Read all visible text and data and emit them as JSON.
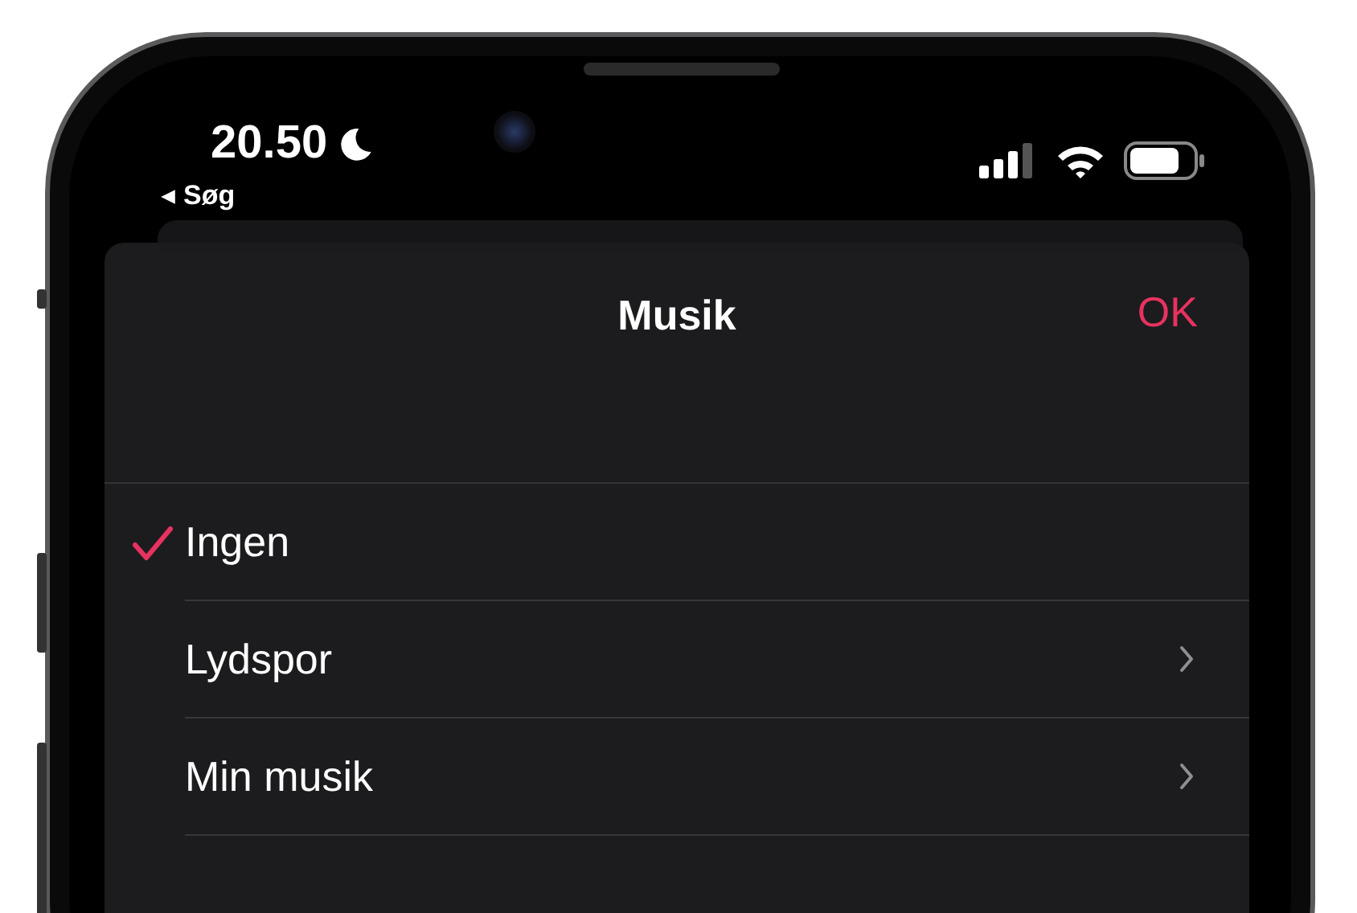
{
  "status_bar": {
    "time": "20.50",
    "back_label": "Søg"
  },
  "sheet": {
    "title": "Musik",
    "done_button": "OK"
  },
  "options": [
    {
      "label": "Ingen",
      "selected": true,
      "kind": "choice"
    },
    {
      "label": "Lydspor",
      "selected": false,
      "kind": "submenu"
    },
    {
      "label": "Min musik",
      "selected": false,
      "kind": "submenu"
    }
  ]
}
